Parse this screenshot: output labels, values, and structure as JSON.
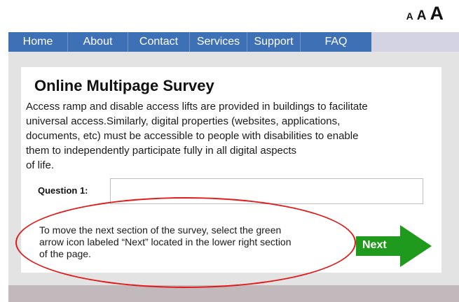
{
  "font_controls": {
    "small": "A",
    "medium": "A",
    "large": "A"
  },
  "nav": {
    "items": [
      {
        "label": "Home"
      },
      {
        "label": "About"
      },
      {
        "label": "Contact"
      },
      {
        "label": "Services"
      },
      {
        "label": "Support"
      },
      {
        "label": "FAQ"
      }
    ]
  },
  "survey": {
    "title": "Online Multipage Survey",
    "intro_lines": [
      "Access ramp and disable access lifts are provided in buildings to facilitate",
      "universal access.Similarly, digital properties (websites, applications,",
      "documents, etc) must be accessible to people with disabilities to enable",
      "them to independently participate fully in all digital aspects",
      "of life."
    ],
    "question_label": "Question 1:",
    "question_value": ""
  },
  "instructions": {
    "lines": [
      "To move the next section of the survey, select the green",
      "arrow icon labeled “Next” located in the lower right section",
      "of the page."
    ]
  },
  "next_button": {
    "label": "Next"
  },
  "colors": {
    "nav_blue": "#3e70b6",
    "nav_extension": "#d4d3e4",
    "next_arrow": "#1f9a1c",
    "annotation": "#e21a1a"
  }
}
